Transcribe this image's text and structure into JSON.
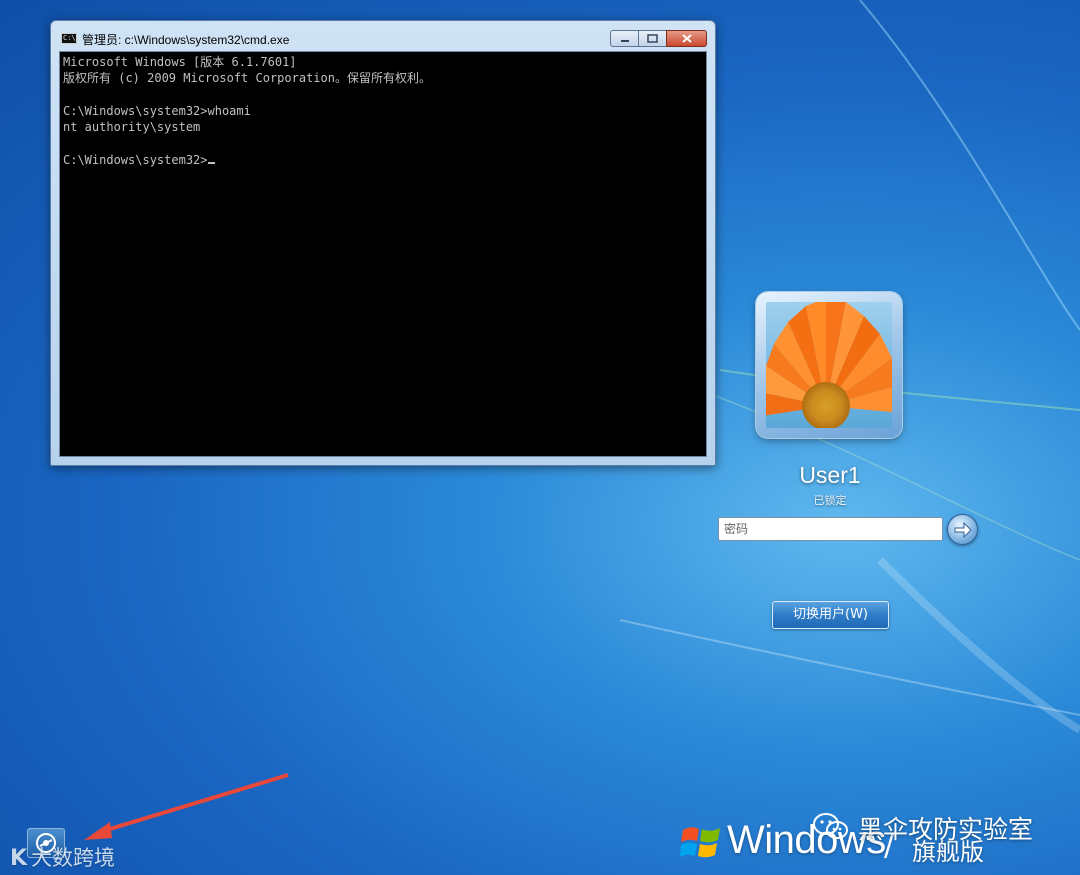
{
  "cmd": {
    "title": "管理员: c:\\Windows\\system32\\cmd.exe",
    "icon_text": "C:\\",
    "minimize_icon": "minimize-icon",
    "maximize_icon": "maximize-icon",
    "close_icon": "close-icon",
    "lines": [
      "Microsoft Windows [版本 6.1.7601]",
      "版权所有 (c) 2009 Microsoft Corporation。保留所有权利。",
      "",
      "C:\\Windows\\system32>whoami",
      "nt authority\\system",
      "",
      "C:\\Windows\\system32>"
    ]
  },
  "logon": {
    "user_name": "User1",
    "status": "已锁定",
    "password_placeholder": "密码",
    "switch_user_label": "切换用户(W)",
    "submit_icon": "arrow-right-icon"
  },
  "branding": {
    "product": "Windows",
    "separator": "/",
    "edition": "旗舰版"
  },
  "watermarks": {
    "left": "大数跨境",
    "left_mark": "K",
    "right": "黑伞攻防实验室"
  },
  "colors": {
    "desktop_blue": "#1a66c2",
    "annotation_arrow": "#e8483a",
    "console_text": "#c0c0c0"
  }
}
